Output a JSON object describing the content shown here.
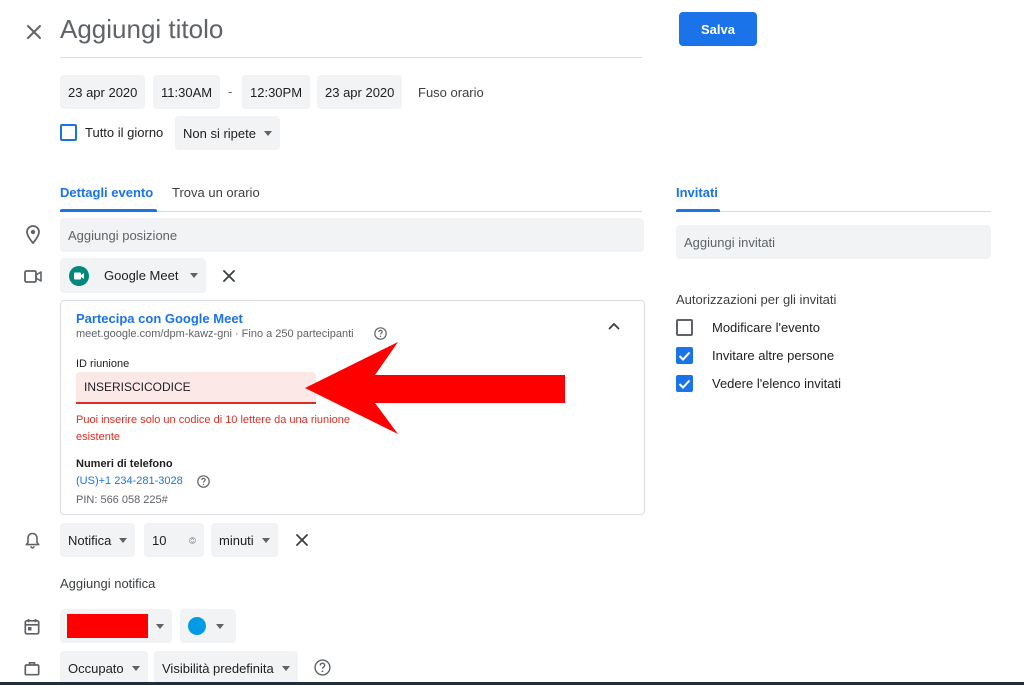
{
  "header": {
    "title_placeholder": "Aggiungi titolo",
    "save_label": "Salva"
  },
  "datetime": {
    "start_date": "23 apr 2020",
    "start_time": "11:30AM",
    "separator": "-",
    "end_time": "12:30PM",
    "end_date": "23 apr 2020",
    "timezone_label": "Fuso orario",
    "all_day_label": "Tutto il giorno",
    "repeat_label": "Non si ripete"
  },
  "tabs": {
    "details": "Dettagli evento",
    "find_time": "Trova un orario",
    "guests": "Invitati"
  },
  "location": {
    "placeholder": "Aggiungi posizione"
  },
  "conference": {
    "provider": "Google Meet",
    "join_title": "Partecipa con Google Meet",
    "join_url": "meet.google.com/dpm-kawz-gni · Fino a 250 partecipanti",
    "meeting_id_label": "ID riunione",
    "meeting_id_value": "INSERISCICODICE",
    "error_line1": "Puoi inserire solo un codice di 10 lettere da una riunione",
    "error_line2": "esistente",
    "phone_label": "Numeri di telefono",
    "phone_number": "(US)+1 234-281-3028",
    "pin": "PIN: 566 058 225#"
  },
  "notification": {
    "type": "Notifica",
    "amount": "10",
    "unit": "minuti",
    "add_label": "Aggiungi notifica"
  },
  "calendar": {
    "color": "#fe0000",
    "event_color": "#039be5"
  },
  "status": {
    "busy": "Occupato",
    "visibility": "Visibilità predefinita"
  },
  "guests": {
    "placeholder": "Aggiungi invitati",
    "permissions_title": "Autorizzazioni per gli invitati",
    "permissions": [
      {
        "label": "Modificare l'evento",
        "checked": false
      },
      {
        "label": "Invitare altre persone",
        "checked": true
      },
      {
        "label": "Vedere l'elenco invitati",
        "checked": true
      }
    ]
  },
  "colors": {
    "accent": "#1a73e8",
    "error": "#d93025",
    "arrow": "#ff0000"
  }
}
